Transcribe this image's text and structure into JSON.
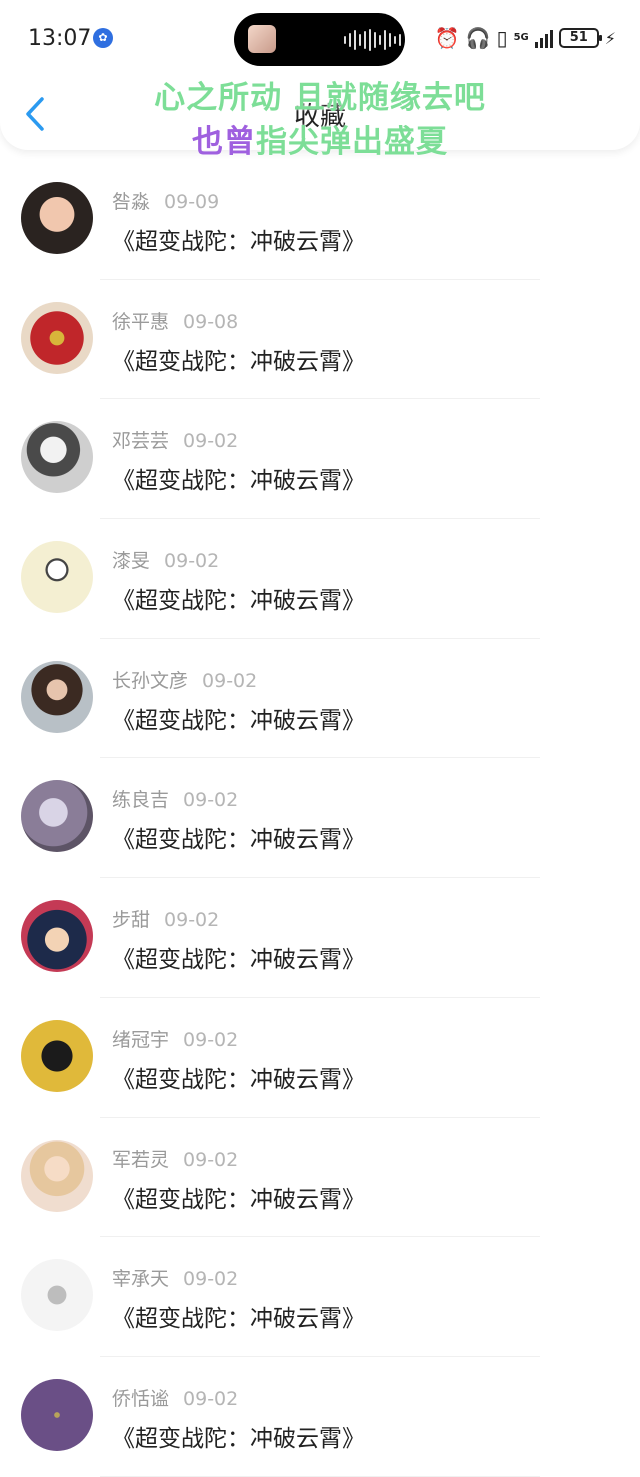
{
  "status_bar": {
    "time": "13:07",
    "network": "5G",
    "battery": "51"
  },
  "header": {
    "title": "收藏"
  },
  "lyrics": {
    "line1": "心之所动 且就随缘去吧",
    "line2_part1": "也曾",
    "line2_part2": "指尖弹出盛夏"
  },
  "colors": {
    "accent": "#2b9af0",
    "lyric_green": "#7dde97",
    "lyric_purple": "#9f60df"
  },
  "favorites": [
    {
      "name": "咎淼",
      "date": "09-09",
      "work": "《超变战陀：冲破云霄》"
    },
    {
      "name": "徐平惠",
      "date": "09-08",
      "work": "《超变战陀：冲破云霄》"
    },
    {
      "name": "邓芸芸",
      "date": "09-02",
      "work": "《超变战陀：冲破云霄》"
    },
    {
      "name": "漆旻",
      "date": "09-02",
      "work": "《超变战陀：冲破云霄》"
    },
    {
      "name": "长孙文彦",
      "date": "09-02",
      "work": "《超变战陀：冲破云霄》"
    },
    {
      "name": "练良吉",
      "date": "09-02",
      "work": "《超变战陀：冲破云霄》"
    },
    {
      "name": "步甜",
      "date": "09-02",
      "work": "《超变战陀：冲破云霄》"
    },
    {
      "name": "绪冠宇",
      "date": "09-02",
      "work": "《超变战陀：冲破云霄》"
    },
    {
      "name": "军若灵",
      "date": "09-02",
      "work": "《超变战陀：冲破云霄》"
    },
    {
      "name": "宰承天",
      "date": "09-02",
      "work": "《超变战陀：冲破云霄》"
    },
    {
      "name": "侨恬谧",
      "date": "09-02",
      "work": "《超变战陀：冲破云霄》"
    }
  ]
}
